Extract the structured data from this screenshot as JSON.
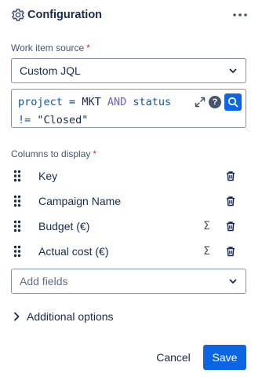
{
  "panel": {
    "title": "Configuration",
    "more_icon": "more-icon",
    "gear_icon": "gear-icon"
  },
  "source": {
    "label": "Work item source",
    "required_mark": "*",
    "value": "Custom JQL"
  },
  "jql": {
    "line1": {
      "field": "project",
      "op": "=",
      "value": "MKT",
      "conj": "AND",
      "field2": "status"
    },
    "line2": {
      "op": "!=",
      "value": "\"Closed\""
    },
    "expand_icon": "expand-icon",
    "help_glyph": "?",
    "search_icon": "search-icon"
  },
  "columns": {
    "label": "Columns to display",
    "required_mark": "*",
    "items": [
      {
        "label": "Key",
        "sigma": ""
      },
      {
        "label": "Campaign Name",
        "sigma": ""
      },
      {
        "label": "Budget (€)",
        "sigma": "Σ"
      },
      {
        "label": "Actual cost (€)",
        "sigma": "Σ"
      }
    ]
  },
  "add_fields": {
    "placeholder": "Add fields"
  },
  "additional": {
    "label": "Additional options"
  },
  "footer": {
    "cancel": "Cancel",
    "save": "Save"
  },
  "colors": {
    "accent": "#0c66e4",
    "required": "#c9372c",
    "text": "#172b4d"
  }
}
